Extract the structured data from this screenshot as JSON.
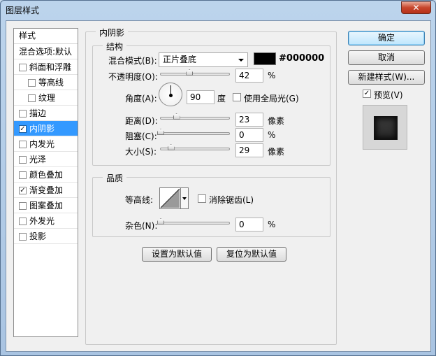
{
  "window": {
    "title": "图层样式",
    "close": "✕"
  },
  "styles": {
    "header": "样式",
    "items": [
      {
        "label": "混合选项:默认",
        "checkbox": false,
        "checked": false,
        "sub": false,
        "selected": false
      },
      {
        "label": "斜面和浮雕",
        "checkbox": true,
        "checked": false,
        "sub": false,
        "selected": false
      },
      {
        "label": "等高线",
        "checkbox": true,
        "checked": false,
        "sub": true,
        "selected": false
      },
      {
        "label": "纹理",
        "checkbox": true,
        "checked": false,
        "sub": true,
        "selected": false
      },
      {
        "label": "描边",
        "checkbox": true,
        "checked": false,
        "sub": false,
        "selected": false
      },
      {
        "label": "内阴影",
        "checkbox": true,
        "checked": true,
        "sub": false,
        "selected": true
      },
      {
        "label": "内发光",
        "checkbox": true,
        "checked": false,
        "sub": false,
        "selected": false
      },
      {
        "label": "光泽",
        "checkbox": true,
        "checked": false,
        "sub": false,
        "selected": false
      },
      {
        "label": "颜色叠加",
        "checkbox": true,
        "checked": false,
        "sub": false,
        "selected": false
      },
      {
        "label": "渐变叠加",
        "checkbox": true,
        "checked": true,
        "sub": false,
        "selected": false
      },
      {
        "label": "图案叠加",
        "checkbox": true,
        "checked": false,
        "sub": false,
        "selected": false
      },
      {
        "label": "外发光",
        "checkbox": true,
        "checked": false,
        "sub": false,
        "selected": false
      },
      {
        "label": "投影",
        "checkbox": true,
        "checked": false,
        "sub": false,
        "selected": false
      }
    ]
  },
  "panel": {
    "title": "内阴影",
    "structure": {
      "title": "结构",
      "blend_mode_label": "混合模式(B):",
      "blend_mode_value": "正片叠底",
      "color_hex": "#000000",
      "opacity_label": "不透明度(O):",
      "opacity_value": "42",
      "opacity_unit": "%",
      "angle_label": "角度(A):",
      "angle_value": "90",
      "angle_unit": "度",
      "global_light_label": "使用全局光(G)",
      "global_light_checked": false,
      "distance_label": "距离(D):",
      "distance_value": "23",
      "distance_unit": "像素",
      "choke_label": "阻塞(C):",
      "choke_value": "0",
      "choke_unit": "%",
      "size_label": "大小(S):",
      "size_value": "29",
      "size_unit": "像素"
    },
    "quality": {
      "title": "品质",
      "contour_label": "等高线:",
      "antialias_label": "消除锯齿(L)",
      "antialias_checked": false,
      "noise_label": "杂色(N):",
      "noise_value": "0",
      "noise_unit": "%"
    },
    "set_default_label": "设置为默认值",
    "reset_default_label": "复位为默认值"
  },
  "actions": {
    "ok_label": "确定",
    "cancel_label": "取消",
    "new_style_label": "新建样式(W)...",
    "preview_label": "预览(V)",
    "preview_checked": true
  },
  "sliders": {
    "opacity": 0.42,
    "distance": 0.23,
    "choke": 0.0,
    "size": 0.15,
    "noise": 0.0
  },
  "colors": {
    "accent": "#3399ff",
    "shadow_color": "#000000"
  }
}
